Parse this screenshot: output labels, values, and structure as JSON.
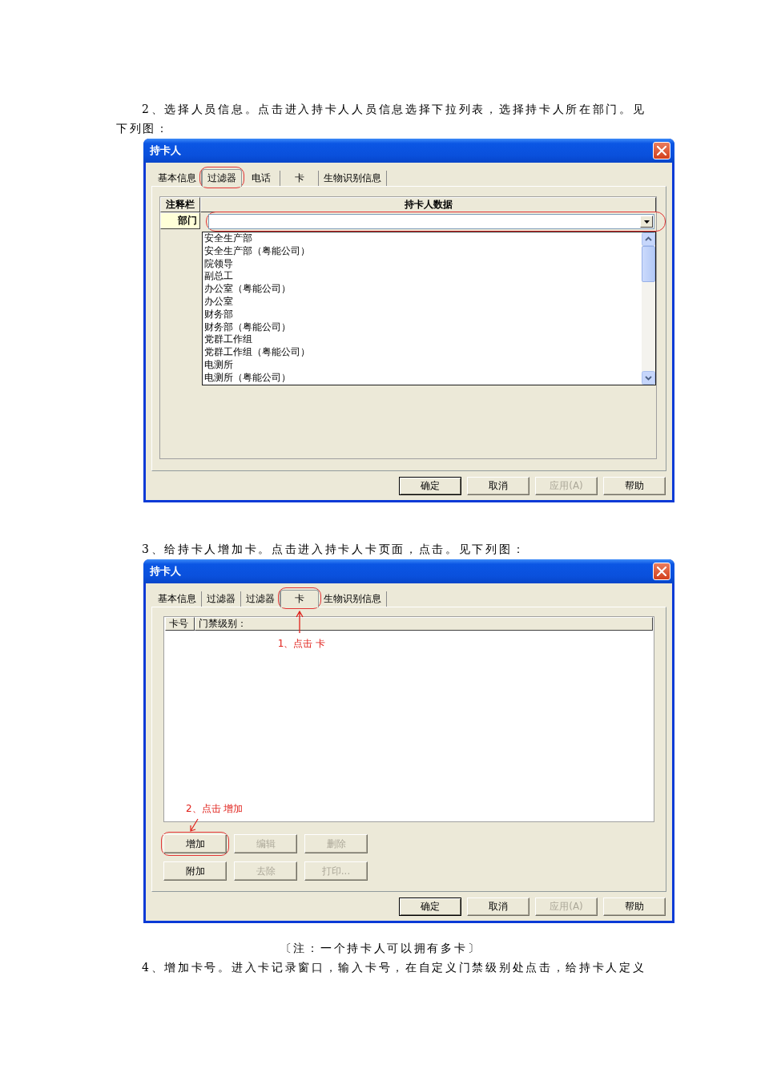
{
  "document": [
    {
      "kind": "paragraph",
      "text": "2、选择人员信息。点击进入持卡人人员信息选择下拉列表，选择持卡人所在部门。见下列图："
    },
    {
      "kind": "dialog",
      "title": "持卡人",
      "tabs": [
        {
          "label": "基本信息",
          "selected": false,
          "circled": false
        },
        {
          "label": "过滤器",
          "selected": true,
          "circled": true
        },
        {
          "label": "电话",
          "selected": false,
          "circled": false
        },
        {
          "label": "卡",
          "selected": false,
          "circled": false
        },
        {
          "label": "生物识别信息",
          "selected": false,
          "circled": false
        }
      ],
      "grid": {
        "columns": [
          "注释栏",
          "持卡人数据"
        ],
        "rows": [
          {
            "label": "部门",
            "combo": {
              "circled": true,
              "expanded": true,
              "options": [
                {
                  "label": "安全生产部",
                  "selected": false
                },
                {
                  "label": "安全生产部（粤能公司）",
                  "selected": false
                },
                {
                  "label": "院领导",
                  "selected": false
                },
                {
                  "label": "副总工",
                  "selected": false
                },
                {
                  "label": "办公室（粤能公司）",
                  "selected": false
                },
                {
                  "label": "办公室",
                  "selected": false
                },
                {
                  "label": "财务部",
                  "selected": false
                },
                {
                  "label": "财务部（粤能公司）",
                  "selected": false
                },
                {
                  "label": "党群工作组",
                  "selected": false
                },
                {
                  "label": "党群工作组（粤能公司）",
                  "selected": false
                },
                {
                  "label": "电测所",
                  "selected": false
                },
                {
                  "label": "电测所（粤能公司）",
                  "selected": false
                }
              ]
            }
          }
        ]
      },
      "buttons": [
        {
          "label": "确定",
          "default": true,
          "disabled": false
        },
        {
          "label": "取消",
          "default": false,
          "disabled": false
        },
        {
          "label": "应用(A)",
          "default": false,
          "disabled": true
        },
        {
          "label": "帮助",
          "default": false,
          "disabled": false
        }
      ]
    },
    {
      "kind": "paragraph",
      "text": "3、给持卡人增加卡。点击进入持卡人卡页面，点击。见下列图："
    },
    {
      "kind": "dialog",
      "title": "持卡人",
      "tabs": [
        {
          "label": "基本信息",
          "selected": false,
          "circled": false
        },
        {
          "label": "过滤器",
          "selected": false,
          "circled": false
        },
        {
          "label": "过滤器",
          "selected": false,
          "circled": false
        },
        {
          "label": "卡",
          "selected": true,
          "circled": true,
          "note": "1、点击 卡"
        },
        {
          "label": "生物识别信息",
          "selected": false,
          "circled": false
        }
      ],
      "list": {
        "columns": [
          "卡号",
          "门禁级别："
        ]
      },
      "action_buttons": [
        [
          {
            "label": "增加",
            "disabled": false,
            "circled": true,
            "note": "2、点击 增加"
          },
          {
            "label": "编辑",
            "disabled": true,
            "circled": false
          },
          {
            "label": "删除",
            "disabled": true,
            "circled": false
          }
        ],
        [
          {
            "label": "附加",
            "disabled": false,
            "circled": false
          },
          {
            "label": "去除",
            "disabled": true,
            "circled": false
          },
          {
            "label": "打印...",
            "disabled": true,
            "circled": false
          }
        ]
      ],
      "buttons": [
        {
          "label": "确定",
          "default": true,
          "disabled": false
        },
        {
          "label": "取消",
          "default": false,
          "disabled": false
        },
        {
          "label": "应用(A)",
          "default": false,
          "disabled": true
        },
        {
          "label": "帮助",
          "default": false,
          "disabled": false
        }
      ]
    },
    {
      "kind": "note",
      "text": "〔注：一个持卡人可以拥有多卡〕"
    },
    {
      "kind": "paragraph",
      "text": "4、增加卡号。进入卡记录窗口，输入卡号，在自定义门禁级别处点击，给持卡人定义"
    }
  ]
}
